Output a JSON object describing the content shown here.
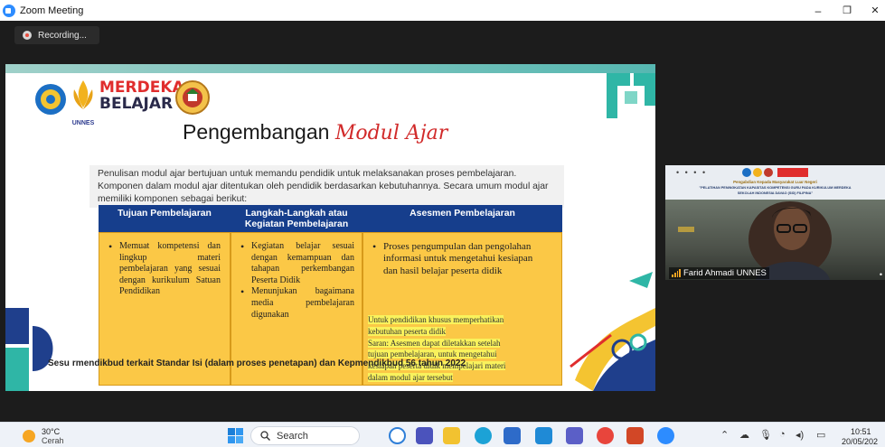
{
  "window": {
    "title": "Zoom Meeting",
    "minimize_icon": "–",
    "restore_icon": "❐",
    "close_icon": "✕"
  },
  "recording": {
    "label": "Recording..."
  },
  "slide": {
    "logo_text": "UNNES",
    "merdeka_line1": "MERDEKA",
    "merdeka_line2": "BELAJAR",
    "title_plain": "Pengembangan",
    "title_highlight": "Modul Ajar",
    "intro_line1": "Penulisan modul ajar bertujuan untuk memandu pendidik untuk melaksanakan proses pembelajaran.",
    "intro_line2": "Komponen dalam modul ajar ditentukan oleh pendidik berdasarkan kebutuhannya.  Secara umum modul ajar",
    "intro_line3": "memiliki komponen sebagai berikut:",
    "headers": [
      "Tujuan Pembelajaran",
      "Langkah-Langkah atau Kegiatan Pembelajaran",
      "Asesmen Pembelajaran"
    ],
    "col1_item": "Memuat kompetensi dan lingkup materi pembelajaran yang sesuai dengan kurikulum Satuan Pendidikan",
    "col2_item1": "Kegiatan belajar sesuai dengan kemampuan dan tahapan perkembangan Peserta Didik",
    "col2_item2": "Menunjukan bagaimana media pembelajaran digunakan",
    "col3_item": "Proses pengumpulan dan pengolahan informasi untuk mengetahui kesiapan dan hasil belajar peserta didik",
    "col3_note_1": "Untuk pendidikan  khusus memperhatikan",
    "col3_note_2": "kebutuhan  peserta didik",
    "col3_note_3": "Saran: Asesmen dapat diletakkan setelah",
    "col3_note_4": "tujuan pembelajaran, untuk mengetahui",
    "col3_note_5": "kesiapan peserta didik mempelajari materi",
    "col3_note_6": "dalam modul ajar tersebut",
    "footer_a": "Sesu",
    "footer_b": "rmendikbud terkait Standar Isi (dalam proses penetapan) dan Kepmendikbud 56 tahun 2022"
  },
  "participant": {
    "name": "Farid Ahmadi UNNES",
    "banner_dots": "• • • •",
    "banner_title": "Pengabdian Kepada Masyarakat Luar Negeri",
    "banner_line1": "\"PELATIHAN PENINGKATAN KAPASITAS KOMPETENSI GURU PADA KURIKULUM MERDEKA",
    "banner_line2": "SEKOLAH INDONESIA DAVAO (SID) FILIPINA\""
  },
  "taskbar": {
    "weather_temp": "30°C",
    "weather_desc": "Cerah",
    "search_label": "Search",
    "time": "10:51",
    "date": "20/05/202"
  },
  "colors": {
    "table_header": "#163e8c",
    "table_body": "#fbc846",
    "title_accent": "#d12a2a",
    "taskbar": "#eef2f8"
  }
}
